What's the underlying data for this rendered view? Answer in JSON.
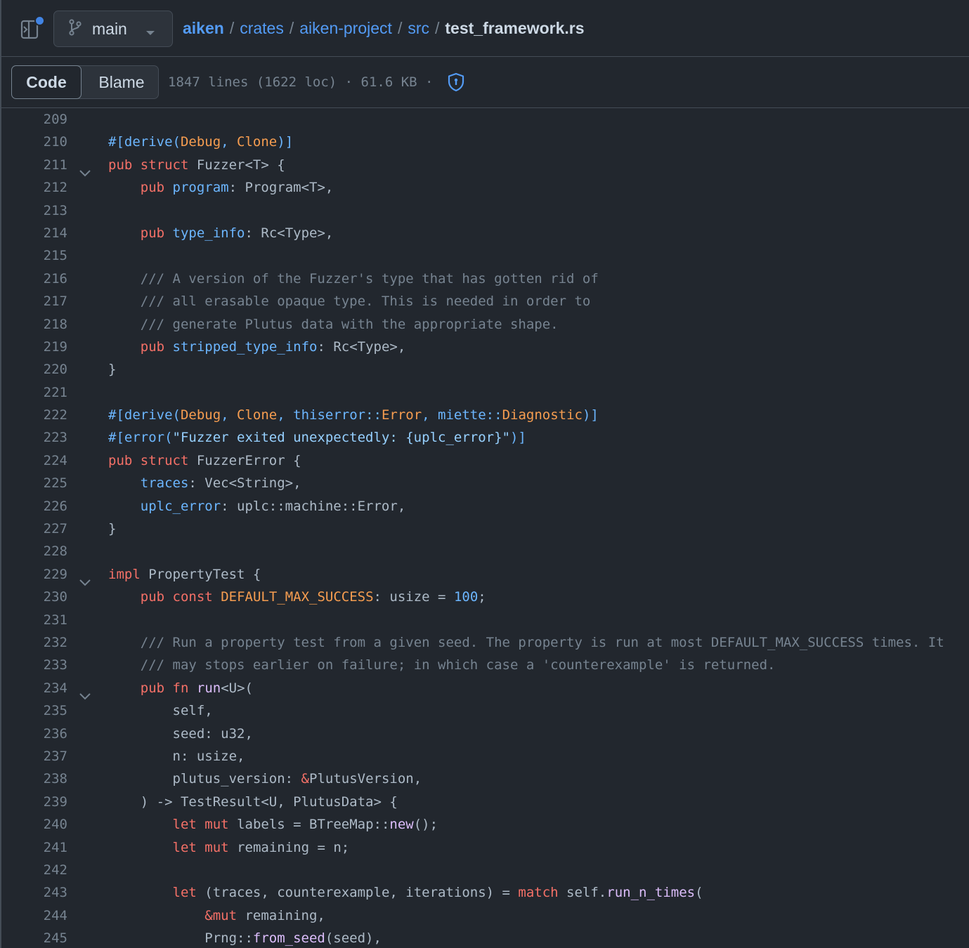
{
  "header": {
    "branch": "main",
    "breadcrumb": [
      "aiken",
      "crates",
      "aiken-project",
      "src"
    ],
    "separator": "/",
    "current_file": "test_framework.rs"
  },
  "toolbar": {
    "tab_code": "Code",
    "tab_blame": "Blame",
    "file_info": "1847 lines (1622 loc) · 61.6 KB ·"
  },
  "colors": {
    "keyword": "#f47067",
    "comment": "#768390",
    "attribute": "#6cb6ff",
    "type": "#f69d50",
    "string": "#96d0ff",
    "function": "#dcbdfb",
    "accent": "#539bf5"
  },
  "icons": [
    "sidebar-toggle-icon",
    "git-branch-icon",
    "caret-down-icon",
    "shield-icon",
    "chevron-down-icon"
  ],
  "code": {
    "lines": [
      {
        "n": "209",
        "fold": false,
        "tokens": []
      },
      {
        "n": "210",
        "fold": false,
        "tokens": [
          [
            "a",
            "#[derive("
          ],
          [
            "t",
            "Debug"
          ],
          [
            "a",
            ", "
          ],
          [
            "t",
            "Clone"
          ],
          [
            "a",
            ")]"
          ]
        ]
      },
      {
        "n": "211",
        "fold": true,
        "tokens": [
          [
            "k",
            "pub"
          ],
          [
            "",
            " "
          ],
          [
            "k",
            "struct"
          ],
          [
            "",
            " Fuzzer<T> {"
          ]
        ]
      },
      {
        "n": "212",
        "fold": false,
        "tokens": [
          [
            "",
            "    "
          ],
          [
            "k",
            "pub"
          ],
          [
            "",
            " "
          ],
          [
            "a",
            "program"
          ],
          [
            "",
            ": Program<T>,"
          ]
        ]
      },
      {
        "n": "213",
        "fold": false,
        "tokens": []
      },
      {
        "n": "214",
        "fold": false,
        "tokens": [
          [
            "",
            "    "
          ],
          [
            "k",
            "pub"
          ],
          [
            "",
            " "
          ],
          [
            "a",
            "type_info"
          ],
          [
            "",
            ": Rc<Type>,"
          ]
        ]
      },
      {
        "n": "215",
        "fold": false,
        "tokens": []
      },
      {
        "n": "216",
        "fold": false,
        "tokens": [
          [
            "",
            "    "
          ],
          [
            "c",
            "/// A version of the Fuzzer's type that has gotten rid of"
          ]
        ]
      },
      {
        "n": "217",
        "fold": false,
        "tokens": [
          [
            "",
            "    "
          ],
          [
            "c",
            "/// all erasable opaque type. This is needed in order to"
          ]
        ]
      },
      {
        "n": "218",
        "fold": false,
        "tokens": [
          [
            "",
            "    "
          ],
          [
            "c",
            "/// generate Plutus data with the appropriate shape."
          ]
        ]
      },
      {
        "n": "219",
        "fold": false,
        "tokens": [
          [
            "",
            "    "
          ],
          [
            "k",
            "pub"
          ],
          [
            "",
            " "
          ],
          [
            "a",
            "stripped_type_info"
          ],
          [
            "",
            ": Rc<Type>,"
          ]
        ]
      },
      {
        "n": "220",
        "fold": false,
        "tokens": [
          [
            "",
            "}"
          ]
        ]
      },
      {
        "n": "221",
        "fold": false,
        "tokens": []
      },
      {
        "n": "222",
        "fold": false,
        "tokens": [
          [
            "a",
            "#[derive("
          ],
          [
            "t",
            "Debug"
          ],
          [
            "a",
            ", "
          ],
          [
            "t",
            "Clone"
          ],
          [
            "a",
            ", thiserror::"
          ],
          [
            "t",
            "Error"
          ],
          [
            "a",
            ", miette::"
          ],
          [
            "t",
            "Diagnostic"
          ],
          [
            "a",
            ")]"
          ]
        ]
      },
      {
        "n": "223",
        "fold": false,
        "tokens": [
          [
            "a",
            "#[error("
          ],
          [
            "s",
            "\"Fuzzer exited unexpectedly: {uplc_error}\""
          ],
          [
            "a",
            ")]"
          ]
        ]
      },
      {
        "n": "224",
        "fold": false,
        "tokens": [
          [
            "k",
            "pub"
          ],
          [
            "",
            " "
          ],
          [
            "k",
            "struct"
          ],
          [
            "",
            " FuzzerError {"
          ]
        ]
      },
      {
        "n": "225",
        "fold": false,
        "tokens": [
          [
            "",
            "    "
          ],
          [
            "a",
            "traces"
          ],
          [
            "",
            ": Vec<String>,"
          ]
        ]
      },
      {
        "n": "226",
        "fold": false,
        "tokens": [
          [
            "",
            "    "
          ],
          [
            "a",
            "uplc_error"
          ],
          [
            "",
            ": uplc::machine::Error,"
          ]
        ]
      },
      {
        "n": "227",
        "fold": false,
        "tokens": [
          [
            "",
            "}"
          ]
        ]
      },
      {
        "n": "228",
        "fold": false,
        "tokens": []
      },
      {
        "n": "229",
        "fold": true,
        "tokens": [
          [
            "k",
            "impl"
          ],
          [
            "",
            " PropertyTest {"
          ]
        ]
      },
      {
        "n": "230",
        "fold": false,
        "tokens": [
          [
            "",
            "    "
          ],
          [
            "k",
            "pub"
          ],
          [
            "",
            " "
          ],
          [
            "k",
            "const"
          ],
          [
            "",
            " "
          ],
          [
            "t",
            "DEFAULT_MAX_SUCCESS"
          ],
          [
            "",
            ": usize = "
          ],
          [
            "a",
            "100"
          ],
          [
            "",
            ";"
          ]
        ]
      },
      {
        "n": "231",
        "fold": false,
        "tokens": []
      },
      {
        "n": "232",
        "fold": false,
        "tokens": [
          [
            "",
            "    "
          ],
          [
            "c",
            "/// Run a property test from a given seed. The property is run at most DEFAULT_MAX_SUCCESS times. It"
          ]
        ]
      },
      {
        "n": "233",
        "fold": false,
        "tokens": [
          [
            "",
            "    "
          ],
          [
            "c",
            "/// may stops earlier on failure; in which case a 'counterexample' is returned."
          ]
        ]
      },
      {
        "n": "234",
        "fold": true,
        "tokens": [
          [
            "",
            "    "
          ],
          [
            "k",
            "pub"
          ],
          [
            "",
            " "
          ],
          [
            "k",
            "fn"
          ],
          [
            "",
            " "
          ],
          [
            "f",
            "run"
          ],
          [
            "",
            "<U>("
          ]
        ]
      },
      {
        "n": "235",
        "fold": false,
        "tokens": [
          [
            "",
            "        self,"
          ]
        ]
      },
      {
        "n": "236",
        "fold": false,
        "tokens": [
          [
            "",
            "        seed: u32,"
          ]
        ]
      },
      {
        "n": "237",
        "fold": false,
        "tokens": [
          [
            "",
            "        n: usize,"
          ]
        ]
      },
      {
        "n": "238",
        "fold": false,
        "tokens": [
          [
            "",
            "        plutus_version: "
          ],
          [
            "k",
            "&"
          ],
          [
            "",
            "PlutusVersion,"
          ]
        ]
      },
      {
        "n": "239",
        "fold": false,
        "tokens": [
          [
            "",
            "    ) -> TestResult<U, PlutusData> {"
          ]
        ]
      },
      {
        "n": "240",
        "fold": false,
        "tokens": [
          [
            "",
            "        "
          ],
          [
            "k",
            "let"
          ],
          [
            "",
            " "
          ],
          [
            "k",
            "mut"
          ],
          [
            "",
            " labels = BTreeMap::"
          ],
          [
            "f",
            "new"
          ],
          [
            "",
            "();"
          ]
        ]
      },
      {
        "n": "241",
        "fold": false,
        "tokens": [
          [
            "",
            "        "
          ],
          [
            "k",
            "let"
          ],
          [
            "",
            " "
          ],
          [
            "k",
            "mut"
          ],
          [
            "",
            " remaining = n;"
          ]
        ]
      },
      {
        "n": "242",
        "fold": false,
        "tokens": []
      },
      {
        "n": "243",
        "fold": false,
        "tokens": [
          [
            "",
            "        "
          ],
          [
            "k",
            "let"
          ],
          [
            "",
            " (traces, counterexample, iterations) = "
          ],
          [
            "k",
            "match"
          ],
          [
            "",
            " self."
          ],
          [
            "f",
            "run_n_times"
          ],
          [
            "",
            "("
          ]
        ]
      },
      {
        "n": "244",
        "fold": false,
        "tokens": [
          [
            "",
            "            "
          ],
          [
            "k",
            "&mut"
          ],
          [
            "",
            " remaining,"
          ]
        ]
      },
      {
        "n": "245",
        "fold": false,
        "tokens": [
          [
            "",
            "            Prng::"
          ],
          [
            "f",
            "from_seed"
          ],
          [
            "",
            "(seed),"
          ]
        ]
      }
    ]
  }
}
